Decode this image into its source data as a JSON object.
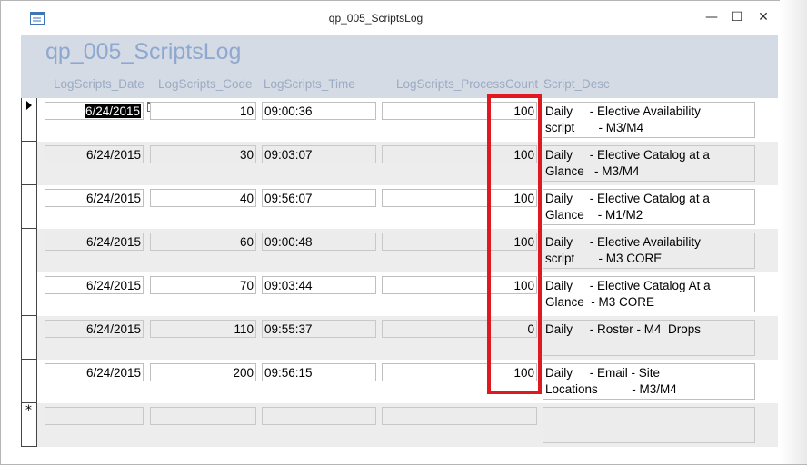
{
  "window": {
    "title": "qp_005_ScriptsLog",
    "controls": {
      "minimize": "—",
      "maximize": "☐",
      "close": "✕"
    }
  },
  "form": {
    "title": "qp_005_ScriptsLog",
    "columns": {
      "date": "LogScripts_Date",
      "code": "LogScripts_Code",
      "time": "LogScripts_Time",
      "count": "LogScripts_ProcessCount",
      "desc": "Script_Desc"
    }
  },
  "rows": [
    {
      "date": "6/24/2015",
      "code": "10",
      "time": "09:00:36",
      "count": "100",
      "desc": "Daily     - Elective Availability\nscript       - M3/M4"
    },
    {
      "date": "6/24/2015",
      "code": "30",
      "time": "09:03:07",
      "count": "100",
      "desc": "Daily     - Elective Catalog at a\nGlance   - M3/M4"
    },
    {
      "date": "6/24/2015",
      "code": "40",
      "time": "09:56:07",
      "count": "100",
      "desc": "Daily     - Elective Catalog at a\nGlance    - M1/M2"
    },
    {
      "date": "6/24/2015",
      "code": "60",
      "time": "09:00:48",
      "count": "100",
      "desc": "Daily     - Elective Availability\nscript       - M3 CORE"
    },
    {
      "date": "6/24/2015",
      "code": "70",
      "time": "09:03:44",
      "count": "100",
      "desc": "Daily     - Elective Catalog At a\nGlance  - M3 CORE"
    },
    {
      "date": "6/24/2015",
      "code": "110",
      "time": "09:55:37",
      "count": "0",
      "desc": "Daily     - Roster - M4  Drops"
    },
    {
      "date": "6/24/2015",
      "code": "200",
      "time": "09:56:15",
      "count": "100",
      "desc": "Daily     - Email - Site\nLocations          - M3/M4"
    }
  ],
  "new_record_marker": "*",
  "colors": {
    "header_bg": "#d5dbe5",
    "title_text": "#8fa8cf",
    "label_text": "#9aabc3",
    "highlight": "#e0191f",
    "alt_row": "#ededed"
  }
}
